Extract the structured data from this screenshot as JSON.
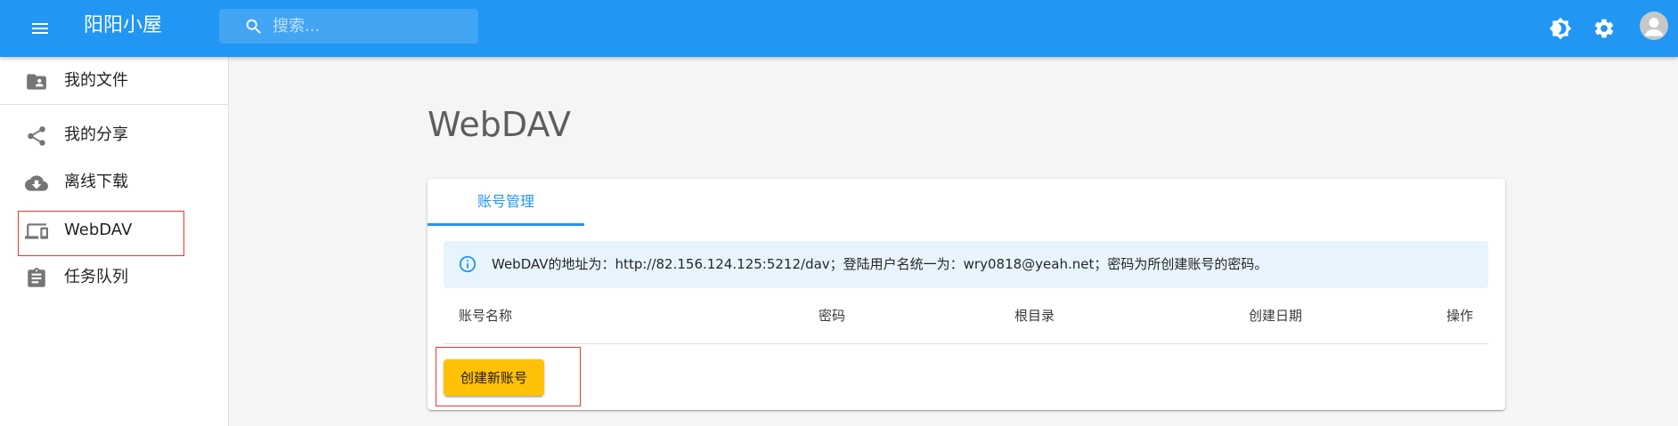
{
  "appbar": {
    "title": "阳阳小屋",
    "search_placeholder": "搜索...",
    "color": "#2196f3"
  },
  "sidebar": {
    "items": [
      {
        "label": "我的文件",
        "icon": "folder-shared-icon"
      },
      {
        "label": "我的分享",
        "icon": "share-icon"
      },
      {
        "label": "离线下载",
        "icon": "cloud-download-icon"
      },
      {
        "label": "WebDAV",
        "icon": "devices-icon",
        "selected": true
      },
      {
        "label": "任务队列",
        "icon": "clipboard-icon"
      }
    ]
  },
  "main": {
    "page_title": "WebDAV",
    "tabs": [
      {
        "label": "账号管理",
        "active": true
      }
    ],
    "alert": {
      "icon": "info-icon",
      "text": "WebDAV的地址为：http://82.156.124.125:5212/dav；登陆用户名统一为：wry0818@yeah.net；密码为所创建账号的密码。"
    },
    "table": {
      "columns": [
        "账号名称",
        "密码",
        "根目录",
        "创建日期",
        "操作"
      ],
      "rows": []
    },
    "create_button": "创建新账号"
  },
  "colors": {
    "primary": "#2196f3",
    "accent_button": "#ffc107",
    "alert_background": "#e8f4fd",
    "highlight_box": "#e53935"
  }
}
